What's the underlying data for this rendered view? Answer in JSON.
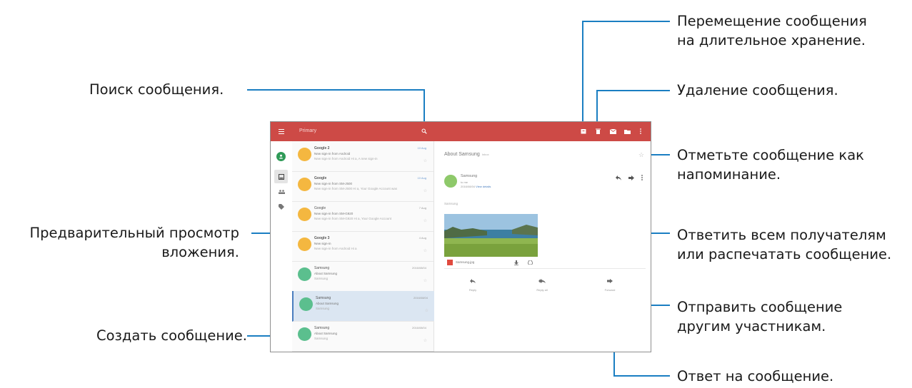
{
  "annotations": {
    "search": [
      "Поиск сообщения."
    ],
    "preview": [
      "Предварительный просмотр",
      "вложения."
    ],
    "compose": [
      "Создать сообщение."
    ],
    "archive": [
      "Перемещение сообщения",
      "на длительное хранение."
    ],
    "delete": [
      "Удаление сообщения."
    ],
    "flag": [
      "Отметьте сообщение как",
      "напоминание."
    ],
    "reply_all": [
      "Ответить всем получателям",
      "или распечатать сообщение."
    ],
    "forward": [
      "Отправить сообщение",
      "другим участникам."
    ],
    "reply": [
      "Ответ на сообщение."
    ]
  },
  "app": {
    "title": "Primary",
    "colors": {
      "accent": "#cd4a46",
      "selected_row": "#dbe6f2",
      "fab": "#d43a36"
    },
    "toolbar_icons": [
      "menu-icon",
      "search-icon",
      "archive-icon",
      "delete-icon",
      "mail-icon",
      "move-icon",
      "more-vert-icon"
    ],
    "rail_icons": [
      "account-icon",
      "inbox-icon",
      "people-icon",
      "label-icon"
    ]
  },
  "messages": [
    {
      "sender": "Google 2",
      "subject": "New sign-in from Android",
      "preview": "New sign-in from Android Hi a, A new sign-in",
      "date": "10 Aug",
      "avatar": "#f4b740"
    },
    {
      "sender": "Google",
      "subject": "New sign-in from SM-J500",
      "preview": "New sign-in from SM-J500 Hi a, Your Google Account was",
      "date": "10 Aug",
      "avatar": "#f4b740"
    },
    {
      "sender": "Google",
      "subject": "New sign-in from SM-G920",
      "preview": "New sign-in from SM-G920 Hi a, Your Google Account",
      "date": "7 Aug",
      "avatar": "#f4b740"
    },
    {
      "sender": "Google 3",
      "subject": "New sign-in",
      "preview": "New sign-in from Android Hi a",
      "date": "4 Aug",
      "avatar": "#f4b740"
    },
    {
      "sender": "Samsung",
      "subject": "About Samsung",
      "preview": "Samsung",
      "date": "2016/08/04",
      "avatar": "#5bbf8e"
    },
    {
      "sender": "Samsung",
      "subject": "About Samsung",
      "preview": "Samsung",
      "date": "2016/08/04",
      "avatar": "#5bbf8e"
    },
    {
      "sender": "Samsung",
      "subject": "About Samsung",
      "preview": "Samsung",
      "date": "2016/08/04",
      "avatar": "#5bbf8e"
    }
  ],
  "reader": {
    "title": "About Samsung",
    "tag": "Inbox",
    "sender": "Samsung",
    "to": "to me",
    "date": "2016/08/04",
    "view_details": "View details",
    "body": "Samsung",
    "attachment": "Samsung.jpg",
    "actions": [
      "Reply",
      "Reply all",
      "Forward"
    ]
  }
}
